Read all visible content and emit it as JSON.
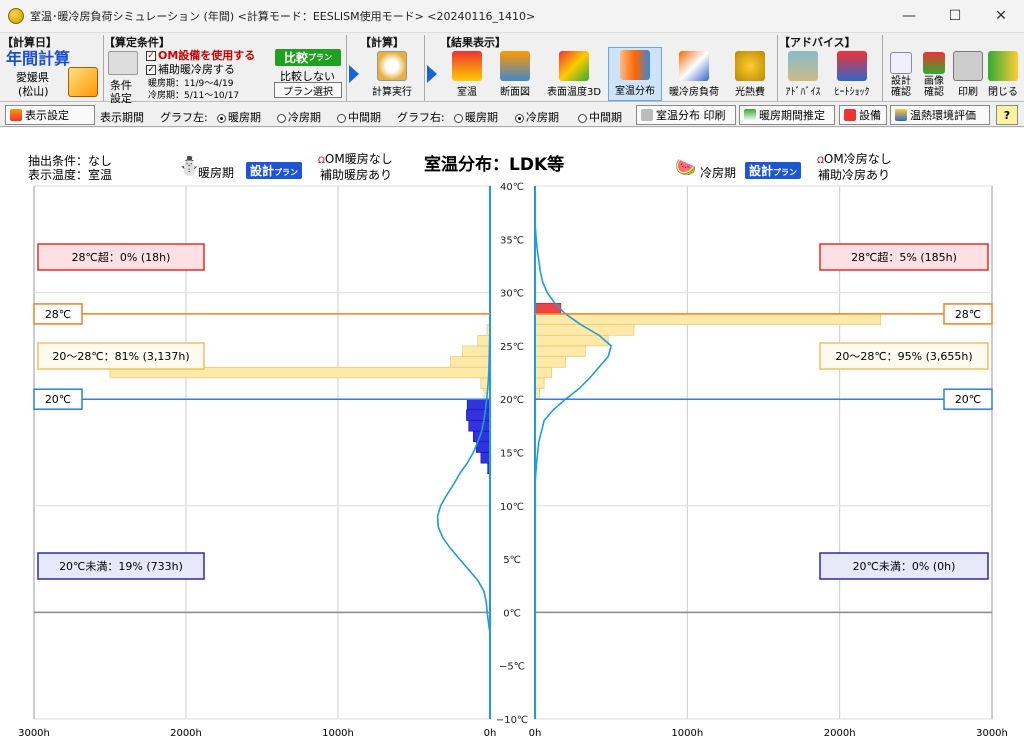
{
  "window": {
    "title": "室温･暖冷房負荷シミュレーション (年間) <計算モード：EESLISM使用モード> <20240116_1410>",
    "minimize": "—",
    "maximize": "☐",
    "close": "✕"
  },
  "ribbon": {
    "calc_day_group": "【計算日】",
    "annual_calc": "年間計算",
    "location": "愛媛県",
    "city": "(松山)",
    "conditions_group": "【算定条件】",
    "cond_setting": "条件",
    "cond_setting2": "設定",
    "om_use": "OM設備を使用する",
    "aux_use": "補助暖冷房する",
    "heating_period": "暖房期：11/9～4/19",
    "cooling_period": "冷房期：5/11～10/17",
    "compare_plan": "比較",
    "compare_plan_small": "プラン",
    "no_compare": "比較しない",
    "plan_select": "プラン選択",
    "calc_group": "【計算】",
    "run_calc": "計算実行",
    "results_group": "【結果表示】",
    "results": [
      "室温",
      "断面図",
      "表面温度3D",
      "室温分布",
      "暖冷房負荷",
      "光熱費"
    ],
    "advice_group": "【アドバイス】",
    "advice": [
      "ｱﾄﾞﾊﾞｲｽ",
      "ﾋｰﾄｼｮｯｸ"
    ],
    "right_tools": [
      "設計確認",
      "画像確認",
      "印刷",
      "閉じる"
    ]
  },
  "toolbar": {
    "display_settings": "表示設定",
    "display_period": "表示期間",
    "graph_left": "グラフ左:",
    "graph_right": "グラフ右:",
    "period_options": [
      "暖房期",
      "冷房期",
      "中間期"
    ],
    "left_selected": 0,
    "right_selected": 1,
    "print_btn": "室温分布 印刷",
    "estimate_btn": "暖房期間推定",
    "equipment_btn": "設備",
    "thermal_btn": "温熱環境評価",
    "help_btn": "?"
  },
  "header": {
    "filter": "抽出条件：なし",
    "display_temp": "表示温度：室温",
    "left_period": "暖房期",
    "plan_badge": "設計",
    "plan_badge_small": "プラン",
    "om_heating": "OM暖房なし",
    "aux_heating": "補助暖房あり",
    "chart_title": "室温分布：LDK等",
    "right_period": "冷房期",
    "om_cooling": "OM冷房なし",
    "aux_cooling": "補助冷房あり"
  },
  "colors": {
    "heating_bar": "#3333dd",
    "cooling_bar": "#fde9a8",
    "cooling_bar_hot": "#ee4444",
    "curve": "#1e9be0",
    "line28": "#f08020",
    "line20": "#2a7fe0",
    "box_hot_bg": "#fde0e3",
    "box_hot_border": "#e03030",
    "box_mid_bg": "#fffaf0",
    "box_mid_border": "#f0c060",
    "box_cold_bg": "#e8e8fb",
    "box_cold_border": "#2a2ab0"
  },
  "chart_data": {
    "type": "bar",
    "title": "室温分布：LDK等",
    "y_axis": {
      "min": -10,
      "max": 40,
      "step": 5,
      "unit": "℃",
      "ticks": [
        "40℃",
        "35℃",
        "30℃",
        "25℃",
        "20℃",
        "15℃",
        "10℃",
        "5℃",
        "0℃",
        "−5℃",
        "−10℃"
      ]
    },
    "x_axis": {
      "max": 3000,
      "unit": "h",
      "left_ticks": [
        "3000h",
        "2000h",
        "1000h",
        "0h"
      ],
      "right_ticks": [
        "0h",
        "1000h",
        "2000h",
        "3000h"
      ]
    },
    "thresholds": [
      {
        "temp": 28,
        "label": "28℃"
      },
      {
        "temp": 20,
        "label": "20℃"
      }
    ],
    "heating": {
      "name": "暖房期",
      "bars": [
        {
          "temp": 19,
          "hours": 150
        },
        {
          "temp": 18,
          "hours": 155
        },
        {
          "temp": 17,
          "hours": 140
        },
        {
          "temp": 16,
          "hours": 110
        },
        {
          "temp": 15,
          "hours": 90
        },
        {
          "temp": 14,
          "hours": 60
        },
        {
          "temp": 13,
          "hours": 15
        },
        {
          "temp": 20,
          "hours": 40
        },
        {
          "temp": 21,
          "hours": 60
        },
        {
          "temp": 22,
          "hours": 2500
        },
        {
          "temp": 23,
          "hours": 260
        },
        {
          "temp": 24,
          "hours": 180
        },
        {
          "temp": 25,
          "hours": 80
        },
        {
          "temp": 26,
          "hours": 20
        }
      ],
      "curve": [
        [
          -2,
          0
        ],
        [
          -1,
          10
        ],
        [
          0,
          18
        ],
        [
          1,
          25
        ],
        [
          2,
          40
        ],
        [
          3,
          80
        ],
        [
          4,
          140
        ],
        [
          5,
          200
        ],
        [
          6,
          260
        ],
        [
          7,
          310
        ],
        [
          8,
          340
        ],
        [
          9,
          345
        ],
        [
          10,
          325
        ],
        [
          11,
          285
        ],
        [
          12,
          240
        ],
        [
          13,
          200
        ],
        [
          14,
          150
        ],
        [
          15,
          110
        ],
        [
          16,
          80
        ],
        [
          17,
          55
        ],
        [
          18,
          40
        ],
        [
          19,
          30
        ],
        [
          20,
          22
        ],
        [
          21,
          15
        ],
        [
          22,
          10
        ],
        [
          23,
          7
        ],
        [
          24,
          5
        ],
        [
          25,
          3
        ],
        [
          26,
          2
        ],
        [
          27,
          0
        ]
      ],
      "boxes": {
        "hot": "28℃超：0% (18h)",
        "mid": "20～28℃：81% (3,137h)",
        "cold": "20℃未満：19% (733h)"
      }
    },
    "cooling": {
      "name": "冷房期",
      "bars": [
        {
          "temp": 20,
          "hours": 30
        },
        {
          "temp": 21,
          "hours": 60
        },
        {
          "temp": 22,
          "hours": 110
        },
        {
          "temp": 23,
          "hours": 200
        },
        {
          "temp": 24,
          "hours": 330
        },
        {
          "temp": 25,
          "hours": 480
        },
        {
          "temp": 26,
          "hours": 650
        },
        {
          "temp": 27,
          "hours": 2270
        },
        {
          "temp": 28,
          "hours": 170
        }
      ],
      "curve": [
        [
          12,
          0
        ],
        [
          14,
          10
        ],
        [
          16,
          25
        ],
        [
          18,
          60
        ],
        [
          19,
          120
        ],
        [
          20,
          200
        ],
        [
          21,
          290
        ],
        [
          22,
          360
        ],
        [
          23,
          420
        ],
        [
          24,
          480
        ],
        [
          25,
          500
        ],
        [
          26,
          420
        ],
        [
          27,
          300
        ],
        [
          28,
          200
        ],
        [
          29,
          130
        ],
        [
          30,
          80
        ],
        [
          31,
          50
        ],
        [
          32,
          35
        ],
        [
          33,
          25
        ],
        [
          34,
          15
        ],
        [
          35,
          8
        ],
        [
          36,
          3
        ],
        [
          37,
          0
        ]
      ],
      "boxes": {
        "hot": "28℃超：5% (185h)",
        "mid": "20～28℃：95% (3,655h)",
        "cold": "20℃未満：0% (0h)"
      }
    }
  }
}
